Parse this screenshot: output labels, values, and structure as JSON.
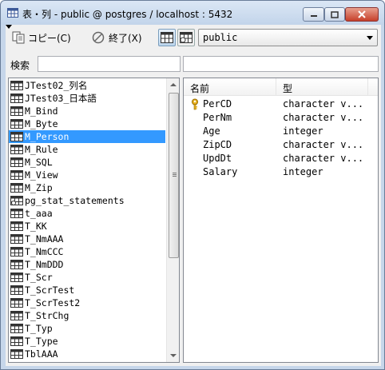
{
  "window": {
    "title": "表・列 - public @ postgres / localhost : 5432"
  },
  "toolbar": {
    "copy_label": "コピー(C)",
    "exit_label": "終了(X)",
    "schema_value": "public"
  },
  "search": {
    "label": "検索",
    "value": ""
  },
  "tables": [
    "JTest02_列名",
    "JTest03_日本語",
    "M_Bind",
    "M_Byte",
    "M_Person",
    "M_Rule",
    "M_SQL",
    "M_View",
    "M_Zip",
    "pg_stat_statements",
    "t_aaa",
    "T_KK",
    "T_NmAAA",
    "T_NmCCC",
    "T_NmDDD",
    "T_Scr",
    "T_ScrTest",
    "T_ScrTest2",
    "T_StrChg",
    "T_Typ",
    "T_Type",
    "TblAAA"
  ],
  "selected_table": "M_Person",
  "columns_header": {
    "name": "名前",
    "type": "型"
  },
  "columns": [
    {
      "name": "PerCD",
      "type": "character v...",
      "primary_key": true
    },
    {
      "name": "PerNm",
      "type": "character v...",
      "primary_key": false
    },
    {
      "name": "Age",
      "type": "integer",
      "primary_key": false
    },
    {
      "name": "ZipCD",
      "type": "character v...",
      "primary_key": false
    },
    {
      "name": "UpdDt",
      "type": "character v...",
      "primary_key": false
    },
    {
      "name": "Salary",
      "type": "integer",
      "primary_key": false
    }
  ],
  "colors": {
    "selection": "#3399ff",
    "frame": "#c6d6ea"
  },
  "icons": {
    "table": "table-icon",
    "view": "view-icon",
    "primary_key": "key-icon"
  }
}
